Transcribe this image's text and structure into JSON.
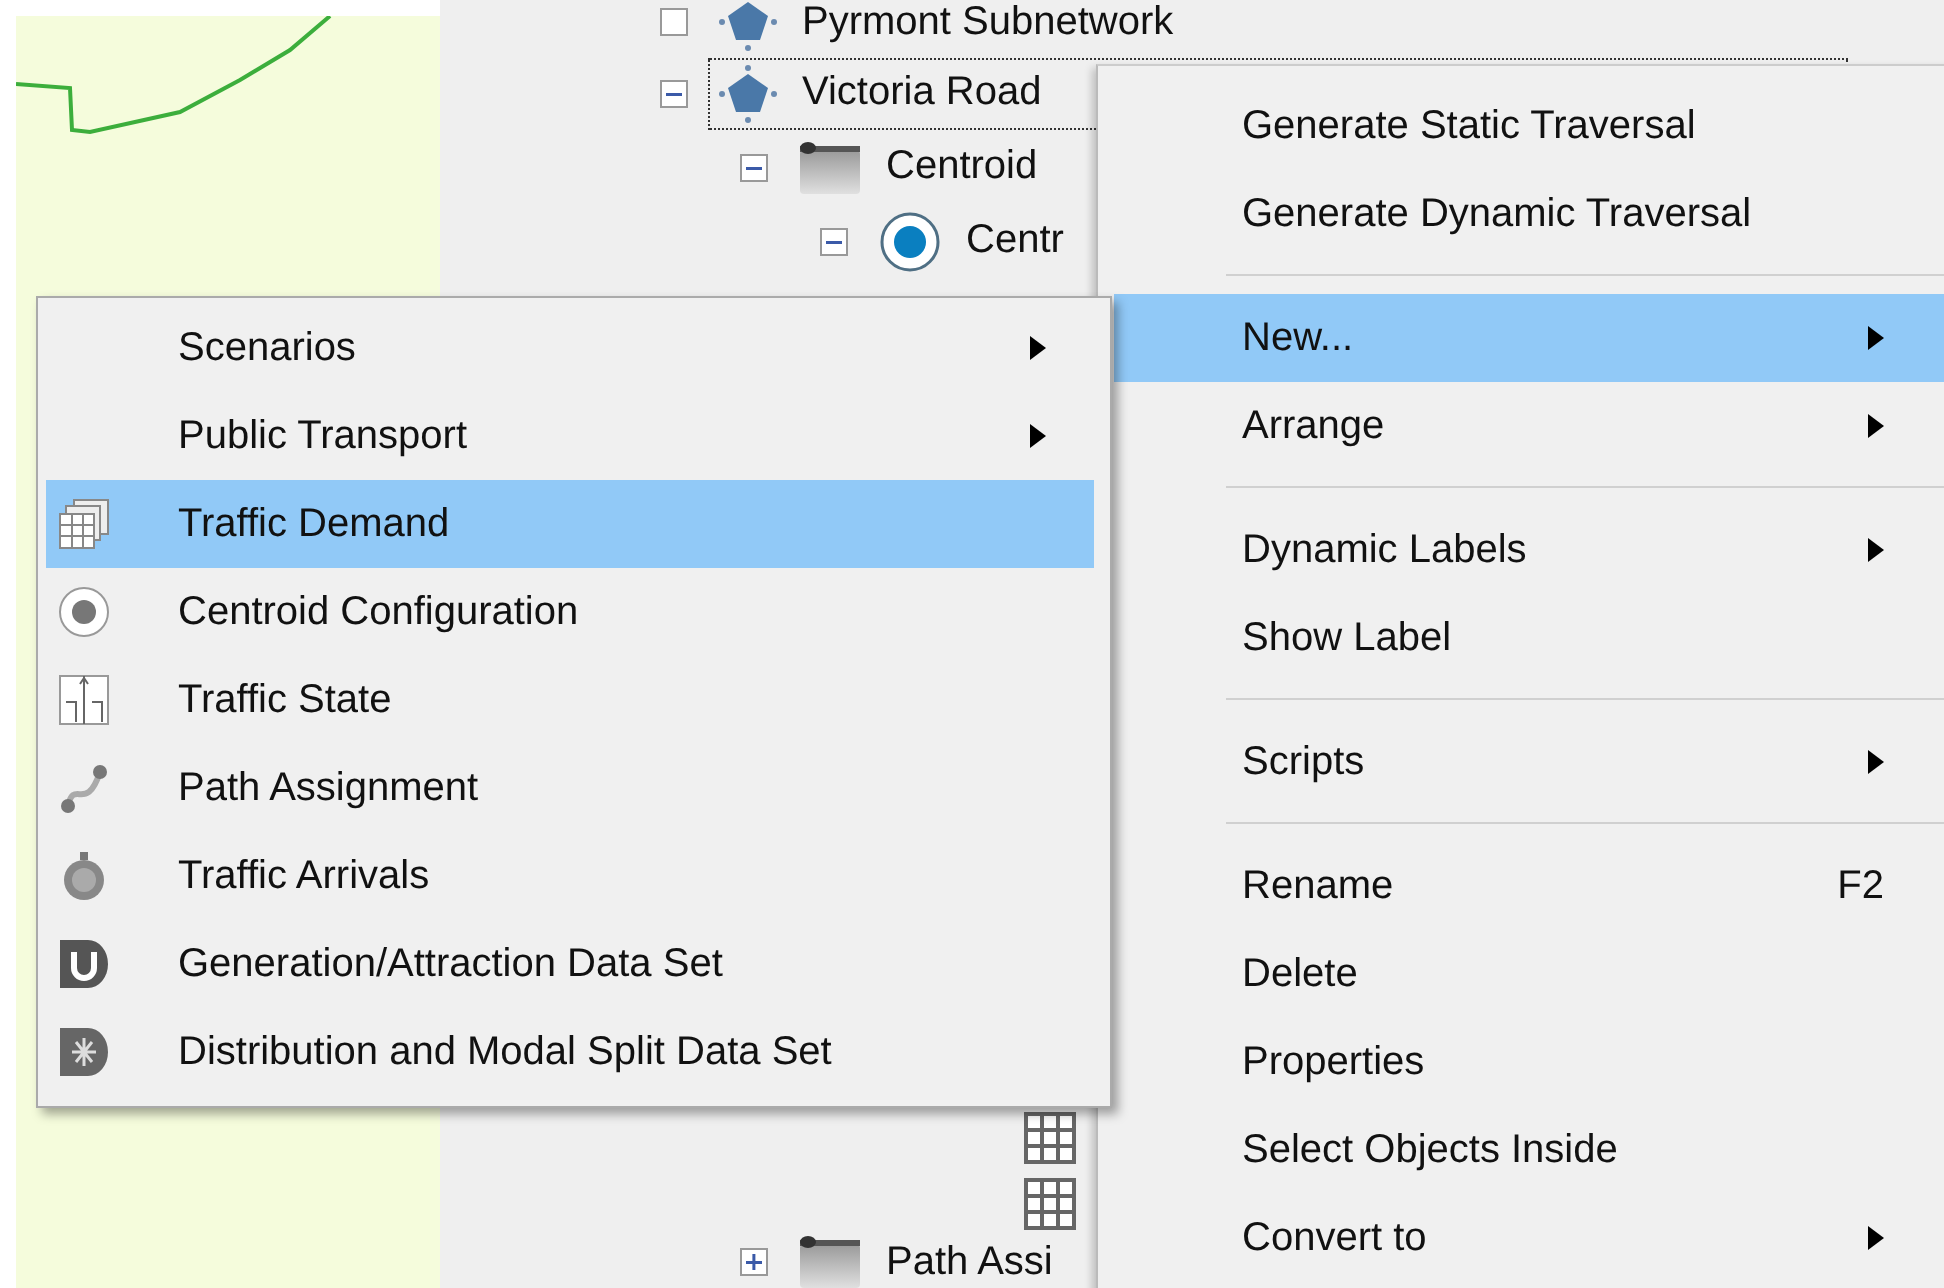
{
  "tree": {
    "items": [
      {
        "label": "Pyrmont Subnetwork",
        "kind": "subnetwork"
      },
      {
        "label": "Victoria Road",
        "kind": "subnetwork",
        "expanded": true,
        "focused": true,
        "children": [
          {
            "label": "Centroid",
            "kind": "folder",
            "expanded": true,
            "children": [
              {
                "label": "Centr",
                "kind": "centroid",
                "expanded": true
              }
            ]
          }
        ]
      }
    ],
    "lower_items": [
      {
        "label": "Path Assi",
        "kind": "folder",
        "expanded": false
      }
    ]
  },
  "context_menu": {
    "groups": [
      [
        {
          "label": "Generate Static Traversal",
          "selected": false,
          "has_submenu": false
        },
        {
          "label": "Generate Dynamic Traversal",
          "selected": false,
          "has_submenu": false
        }
      ],
      [
        {
          "label": "New...",
          "selected": true,
          "has_submenu": true
        },
        {
          "label": "Arrange",
          "selected": false,
          "has_submenu": true
        }
      ],
      [
        {
          "label": "Dynamic Labels",
          "selected": false,
          "has_submenu": true
        },
        {
          "label": "Show Label",
          "selected": false,
          "has_submenu": false
        }
      ],
      [
        {
          "label": "Scripts",
          "selected": false,
          "has_submenu": true
        }
      ],
      [
        {
          "label": "Rename",
          "selected": false,
          "has_submenu": false,
          "shortcut": "F2"
        },
        {
          "label": "Delete",
          "selected": false,
          "has_submenu": false
        },
        {
          "label": "Properties",
          "selected": false,
          "has_submenu": false
        },
        {
          "label": "Select Objects Inside",
          "selected": false,
          "has_submenu": false
        },
        {
          "label": "Convert to",
          "selected": false,
          "has_submenu": true
        }
      ]
    ]
  },
  "submenu": {
    "items": [
      {
        "label": "Scenarios",
        "selected": false,
        "has_submenu": true
      },
      {
        "label": "Public Transport",
        "selected": false,
        "has_submenu": true
      },
      {
        "label": "Traffic Demand",
        "selected": true,
        "has_submenu": false
      },
      {
        "label": "Centroid Configuration",
        "selected": false,
        "has_submenu": false
      },
      {
        "label": "Traffic State",
        "selected": false,
        "has_submenu": false
      },
      {
        "label": "Path Assignment",
        "selected": false,
        "has_submenu": false
      },
      {
        "label": "Traffic Arrivals",
        "selected": false,
        "has_submenu": false
      },
      {
        "label": "Generation/Attraction Data Set",
        "selected": false,
        "has_submenu": false
      },
      {
        "label": "Distribution and Modal Split Data Set",
        "selected": false,
        "has_submenu": false
      }
    ]
  }
}
